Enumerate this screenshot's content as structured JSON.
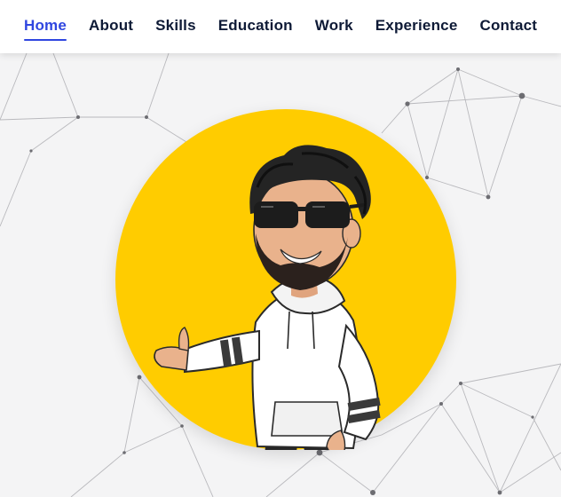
{
  "nav": {
    "items": [
      {
        "label": "Home",
        "active": true
      },
      {
        "label": "About",
        "active": false
      },
      {
        "label": "Skills",
        "active": false
      },
      {
        "label": "Education",
        "active": false
      },
      {
        "label": "Work",
        "active": false
      },
      {
        "label": "Experience",
        "active": false
      },
      {
        "label": "Contact",
        "active": false
      }
    ],
    "active_color": "#2f46e0",
    "text_color": "#0e1a36"
  },
  "hero": {
    "background_pattern": "network-icon",
    "avatar": {
      "icon": "avatar-icon",
      "circle_color": "#ffcc00"
    }
  }
}
